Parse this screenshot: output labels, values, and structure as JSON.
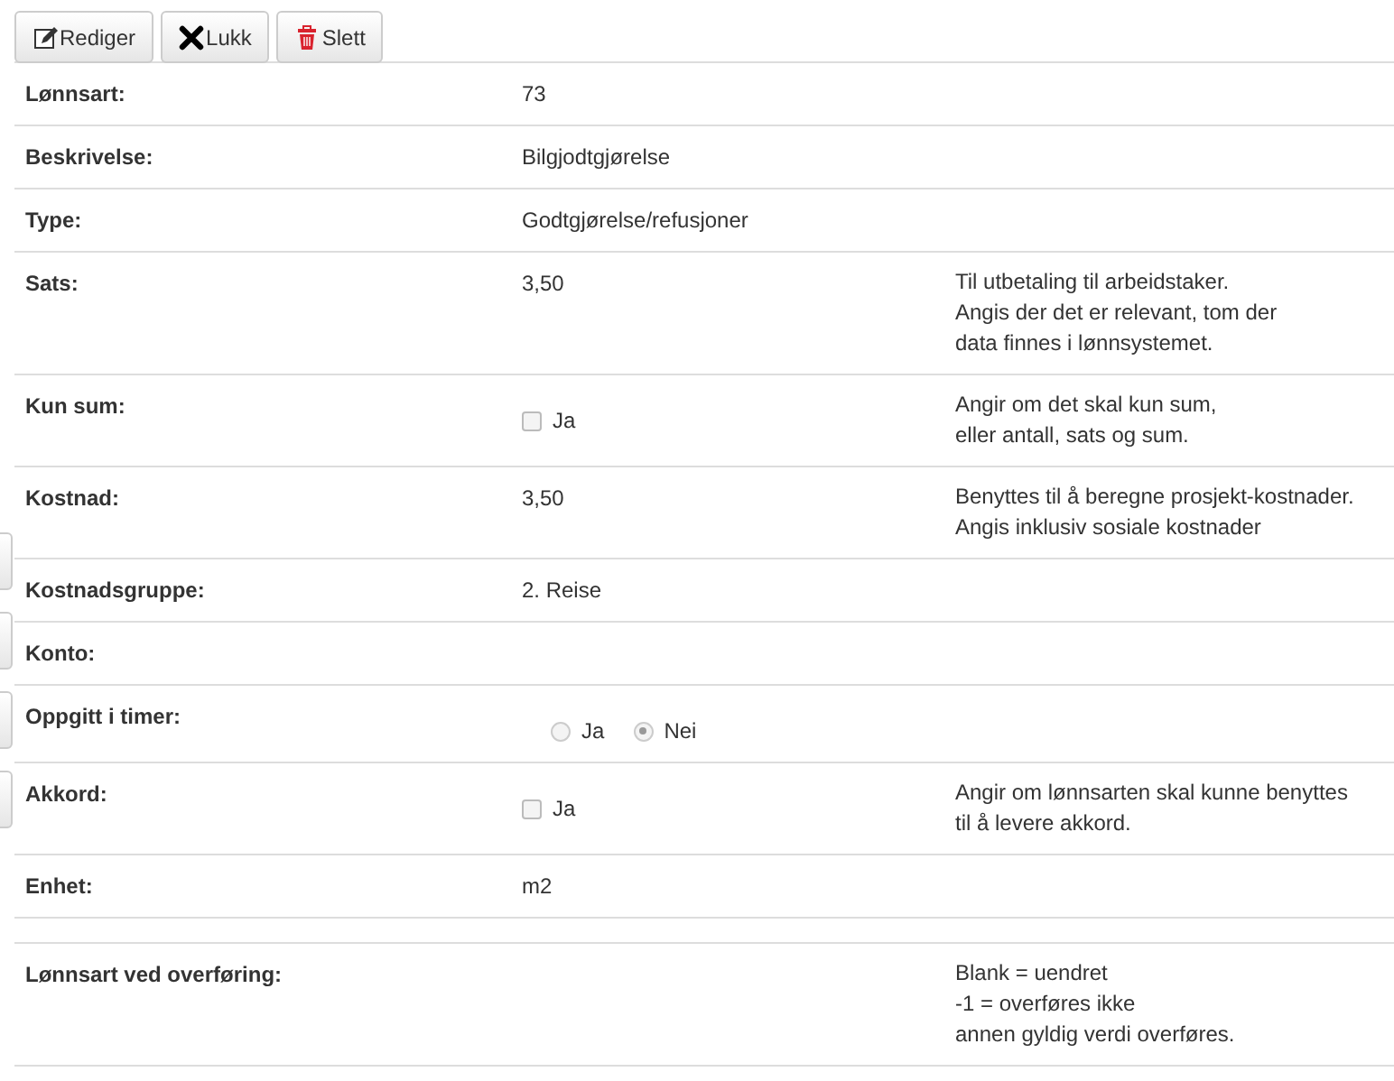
{
  "toolbar": [
    {
      "kind": "edit",
      "label": "Rediger"
    },
    {
      "kind": "close",
      "label": "Lukk"
    },
    {
      "kind": "delete",
      "label": "Slett"
    }
  ],
  "side_tabs": [
    {
      "kind": "tab"
    },
    {
      "kind": "tab"
    },
    {
      "kind": "tab"
    },
    {
      "kind": "tab"
    }
  ],
  "fields": [
    {
      "label": "Lønnsart:",
      "kind": "text",
      "value": "73"
    },
    {
      "label": "Beskrivelse:",
      "kind": "text",
      "value": "Bilgjodtgjørelse"
    },
    {
      "label": "Type:",
      "kind": "text",
      "value": "Godtgjørelse/refusjoner"
    },
    {
      "label": "Sats:",
      "kind": "text",
      "value": "3,50",
      "help": [
        "Til utbetaling til arbeidstaker.",
        "Angis der det er relevant, tom der",
        "data finnes i lønnsystemet."
      ]
    },
    {
      "label": "Kun sum:",
      "kind": "checkbox",
      "option": "Ja",
      "checked": false,
      "help": [
        "Angir om det skal kun sum,",
        "eller antall, sats og sum."
      ]
    },
    {
      "label": "Kostnad:",
      "kind": "text",
      "value": "3,50",
      "help": [
        "Benyttes til å beregne prosjekt-kostnader.",
        "Angis inklusiv sosiale kostnader"
      ]
    },
    {
      "label": "Kostnadsgruppe:",
      "kind": "text",
      "value": "2. Reise"
    },
    {
      "label": "Konto:",
      "kind": "text"
    },
    {
      "label": "Oppgitt i timer:",
      "kind": "radio",
      "options": [
        {
          "label": "Ja",
          "selected": false
        },
        {
          "label": "Nei",
          "selected": true
        }
      ]
    },
    {
      "label": "Akkord:",
      "kind": "checkbox",
      "option": "Ja",
      "checked": false,
      "help": [
        "Angir om lønnsarten skal kunne benyttes",
        "til å levere akkord."
      ]
    },
    {
      "label": "Enhet:",
      "kind": "text",
      "value": "m2"
    },
    {
      "kind": "gap"
    },
    {
      "label": "Lønnsart ved overføring:",
      "kind": "text",
      "help": [
        "Blank = uendret",
        "-1 = overføres ikke",
        "annen gyldig verdi overføres."
      ]
    }
  ]
}
